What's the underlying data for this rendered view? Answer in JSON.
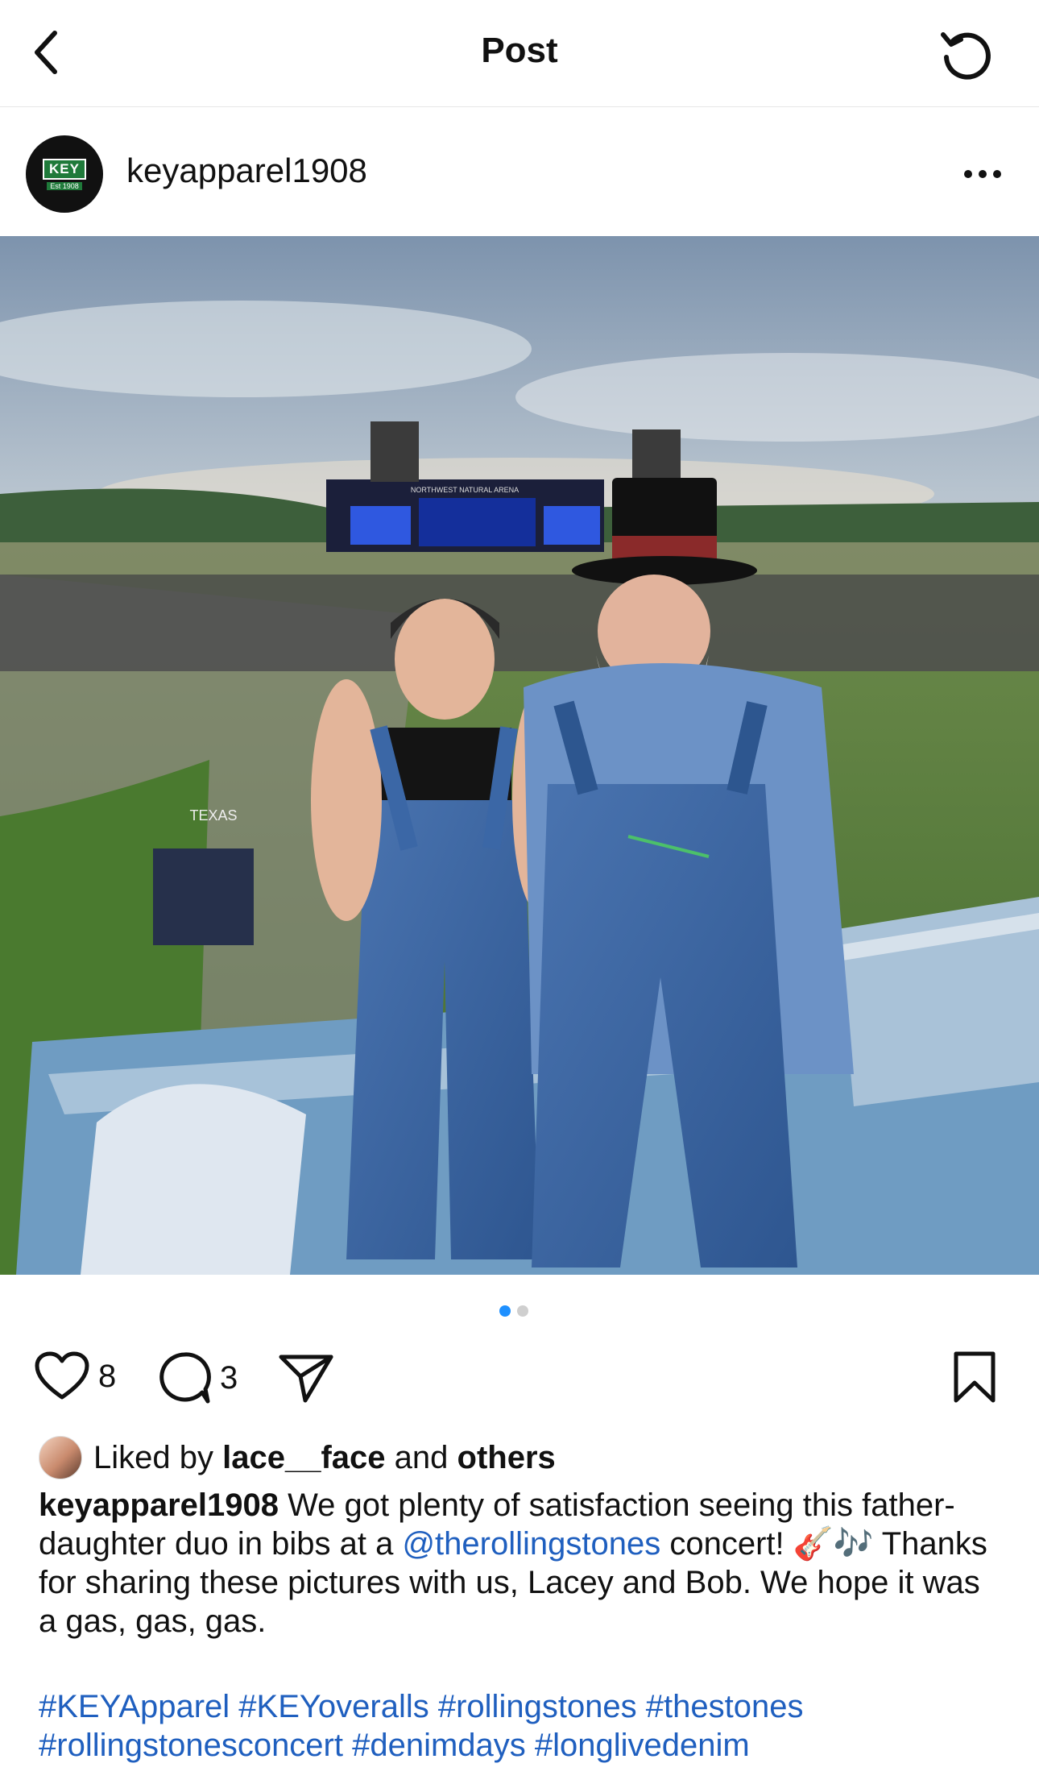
{
  "topbar": {
    "title": "Post",
    "back_icon": "chevron-left-icon",
    "refresh_icon": "refresh-icon"
  },
  "post": {
    "username": "keyapparel1908",
    "avatar": {
      "brand": "KEY",
      "est": "Est 1908"
    },
    "more_icon": "more-horizontal-icon",
    "photo": {
      "stage_sign": "NORTHWEST NATURAL ARENA",
      "shirt_text": "TEXAS"
    },
    "carousel": {
      "count": 2,
      "active_index": 0
    },
    "actions": {
      "likes_count": "8",
      "comments_count": "3",
      "like_icon": "heart-icon",
      "comment_icon": "comment-icon",
      "share_icon": "send-icon",
      "save_icon": "bookmark-icon"
    },
    "liked_by": {
      "prefix": "Liked by",
      "user": "lace__face",
      "and": "and",
      "others": "others"
    },
    "caption": {
      "username": "keyapparel1908",
      "text1": " We got plenty of satisfaction seeing this father-daughter duo in bibs at a ",
      "mention": "@therollingstones",
      "text2": " concert! 🎸🎶 Thanks for sharing these pictures with us, Lacey and Bob. We hope it was a gas, gas, gas."
    },
    "hashtags": "#KEYApparel #KEYoveralls #rollingstones #thestones #rollingstonesconcert #denimdays #longlivedenim"
  },
  "colors": {
    "link": "#1f5fbf",
    "active_dot": "#1e90ff",
    "brand_green": "#1f7a3a"
  }
}
